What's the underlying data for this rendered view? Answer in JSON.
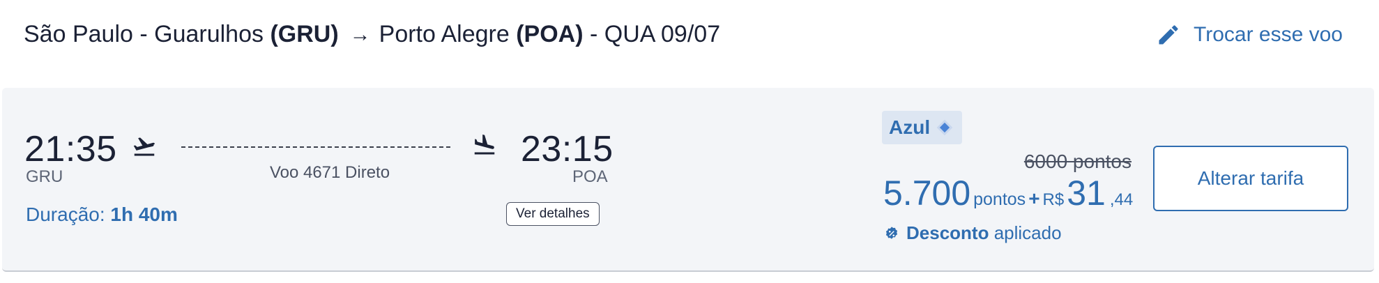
{
  "route": {
    "origin_city": "São Paulo - Guarulhos",
    "origin_code": "(GRU)",
    "arrow": "→",
    "destination_city": "Porto Alegre",
    "destination_code": "(POA)",
    "date": "- QUA 09/07"
  },
  "change_flight": {
    "label": "Trocar esse voo",
    "icon": "pencil-icon"
  },
  "flight": {
    "departure_time": "21:35",
    "departure_code": "GRU",
    "arrival_time": "23:15",
    "arrival_code": "POA",
    "info": "Voo 4671 Direto",
    "duration_label": "Duração:",
    "duration_value": "1h 40m",
    "details_label": "Ver detalhes",
    "takeoff_icon": "takeoff-icon",
    "landing_icon": "landing-icon"
  },
  "fare": {
    "airline": "Azul",
    "original_price": "6000 pontos",
    "points": "5.700",
    "points_unit": "pontos",
    "plus": "+",
    "currency": "R$",
    "cash": "31",
    "cents": ",44",
    "discount_bold": "Desconto",
    "discount_text": "aplicado",
    "change_fare_label": "Alterar tarifa"
  },
  "colors": {
    "accent": "#2f6db0",
    "text": "#1b2135",
    "card_bg": "#f3f5f8",
    "badge_bg": "#dde6f2"
  }
}
